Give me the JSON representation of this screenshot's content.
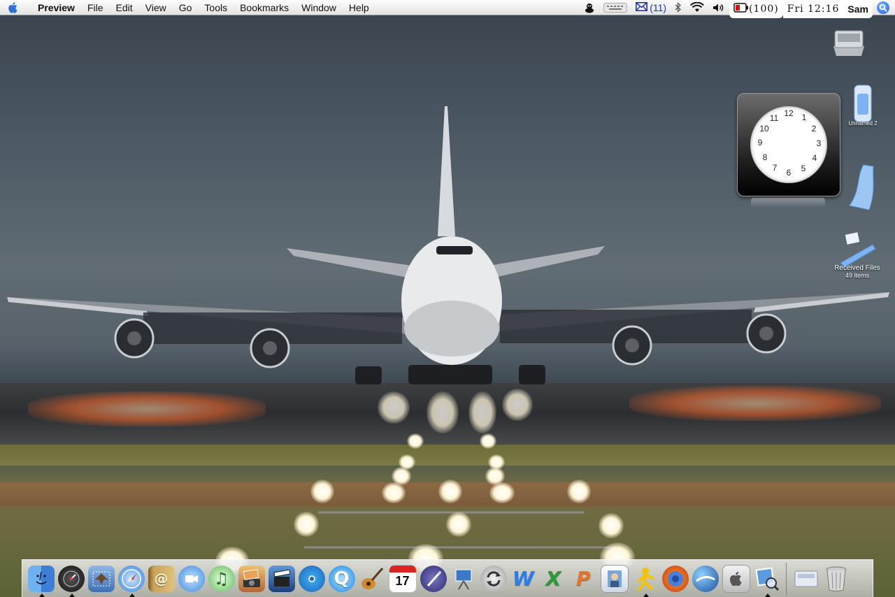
{
  "menubar": {
    "app_name": "Preview",
    "menus": [
      "File",
      "Edit",
      "View",
      "Go",
      "Tools",
      "Bookmarks",
      "Window",
      "Help"
    ],
    "mail_count": "(11)",
    "battery_text": "(100)",
    "clock_text": "Fri 12:16",
    "user": "Sam"
  },
  "desktop": {
    "icons": [
      {
        "name": "hard-drive",
        "label": ""
      },
      {
        "name": "drive-2",
        "label": "Unnamed 2"
      },
      {
        "name": "folder-stack",
        "label": ""
      },
      {
        "name": "received-files",
        "label": "Received Files",
        "sublabel": "49 items"
      }
    ]
  },
  "clock_widget": {
    "numbers": [
      "12",
      "1",
      "2",
      "3",
      "4",
      "5",
      "6",
      "7",
      "8",
      "9",
      "10",
      "11"
    ]
  },
  "dock": {
    "apps": [
      {
        "name": "finder",
        "running": true
      },
      {
        "name": "dashboard",
        "running": true
      },
      {
        "name": "mail",
        "running": false
      },
      {
        "name": "safari",
        "running": true
      },
      {
        "name": "address-book",
        "running": false
      },
      {
        "name": "ichat",
        "running": false
      },
      {
        "name": "itunes",
        "running": false
      },
      {
        "name": "iphoto",
        "running": false
      },
      {
        "name": "imovie",
        "running": false
      },
      {
        "name": "idvd",
        "running": false
      },
      {
        "name": "quicktime",
        "running": false
      },
      {
        "name": "garageband",
        "running": false
      },
      {
        "name": "ical",
        "running": false,
        "badge": "17"
      },
      {
        "name": "iweb",
        "running": false
      },
      {
        "name": "keynote",
        "running": false
      },
      {
        "name": "isync",
        "running": false
      },
      {
        "name": "word",
        "running": false
      },
      {
        "name": "excel",
        "running": false
      },
      {
        "name": "powerpoint",
        "running": false
      },
      {
        "name": "photo-booth",
        "running": false
      },
      {
        "name": "aim",
        "running": true
      },
      {
        "name": "firefox",
        "running": false
      },
      {
        "name": "google-earth",
        "running": false
      },
      {
        "name": "system-preferences",
        "running": false
      },
      {
        "name": "preview",
        "running": true
      }
    ],
    "right": [
      {
        "name": "documents-stack"
      },
      {
        "name": "trash"
      }
    ]
  }
}
